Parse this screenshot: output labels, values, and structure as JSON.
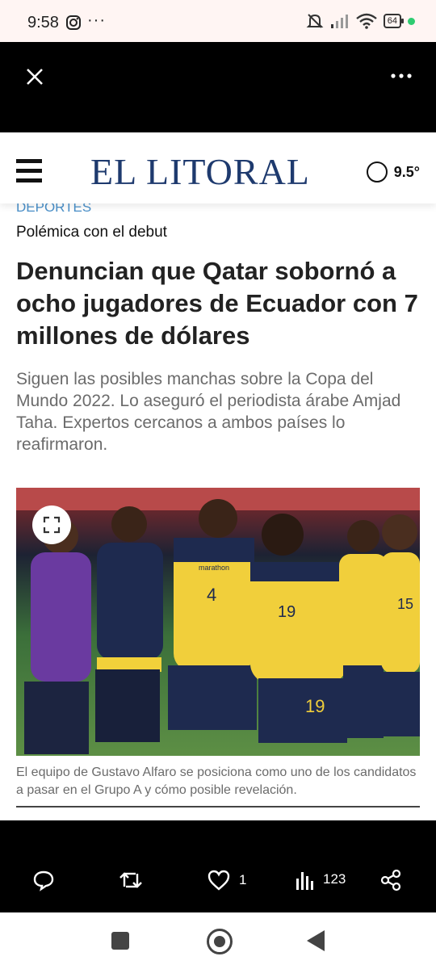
{
  "status_bar": {
    "time": "9:58",
    "overflow": "···",
    "battery": "64",
    "icons": [
      "instagram-icon",
      "silent-bell-icon",
      "signal-icon",
      "wifi-icon",
      "battery-icon",
      "green-dot-icon"
    ]
  },
  "viewer": {
    "close_icon": "close-icon",
    "more_icon": "more-icon"
  },
  "site": {
    "logo": "EL LITORAL",
    "temperature": "9.5°",
    "menu_icon": "hamburger-icon",
    "weather_icon": "moon-icon",
    "brand_color": "#1e3a6e"
  },
  "article": {
    "section": "DEPORTES",
    "kicker": "Polémica con el debut",
    "headline": "Denuncian que Qatar sobornó a ocho jugadores de Ecuador con 7 millones de dólares",
    "deck": "Siguen las posibles manchas sobre la Copa del Mundo 2022. Lo aseguró el periodista árabe Amjad Taha. Expertos cercanos a ambos países lo reafirmaron.",
    "photo_caption": "El equipo de Gustavo Alfaro se posiciona como uno de los candidatos a pasar en el Grupo A y cómo posible revelación.",
    "section_color": "#4a90c9"
  },
  "photo": {
    "jerseys": [
      "4",
      "19",
      "19",
      "15"
    ],
    "brand": "marathon"
  },
  "actions": {
    "likes": "1",
    "views": "123"
  }
}
